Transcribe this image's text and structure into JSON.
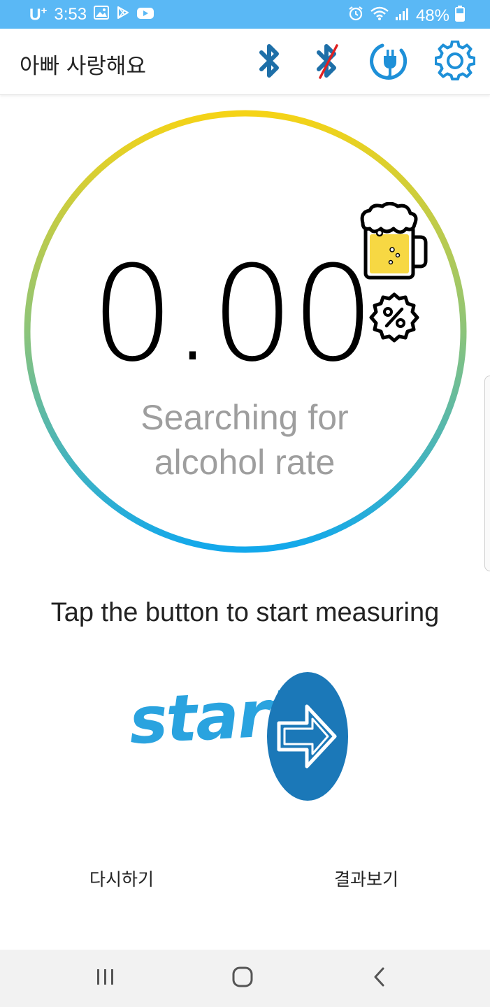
{
  "status_bar": {
    "carrier": "U",
    "carrier_sup": "+",
    "time": "3:53",
    "battery": "48%",
    "icons": [
      "gallery-icon",
      "play-store-icon",
      "youtube-icon",
      "alarm-icon",
      "wifi-icon",
      "signal-icon",
      "battery-icon"
    ]
  },
  "toolbar": {
    "title": "아빠 사랑해요",
    "icons": [
      "bluetooth-icon",
      "bluetooth-disabled-icon",
      "power-plug-icon",
      "settings-gear-icon"
    ]
  },
  "gauge": {
    "reading": "0.00",
    "status_line1": "Searching for",
    "status_line2": "alcohol rate",
    "icons": [
      "beer-mug-icon",
      "percent-badge-icon"
    ]
  },
  "instruction": "Tap the button to start measuring",
  "start_button": {
    "label": "start",
    "icon": "arrow-right-icon"
  },
  "actions": {
    "retry": "다시하기",
    "results": "결과보기"
  },
  "nav_bar": {
    "icons": [
      "recent-apps-icon",
      "home-icon",
      "back-icon"
    ]
  },
  "colors": {
    "status_bar": "#5ab8f5",
    "accent_blue": "#1e90d8",
    "ring_yellow": "#f5d316",
    "ring_blue": "#12a8ec",
    "start_blue": "#1b78b8"
  }
}
